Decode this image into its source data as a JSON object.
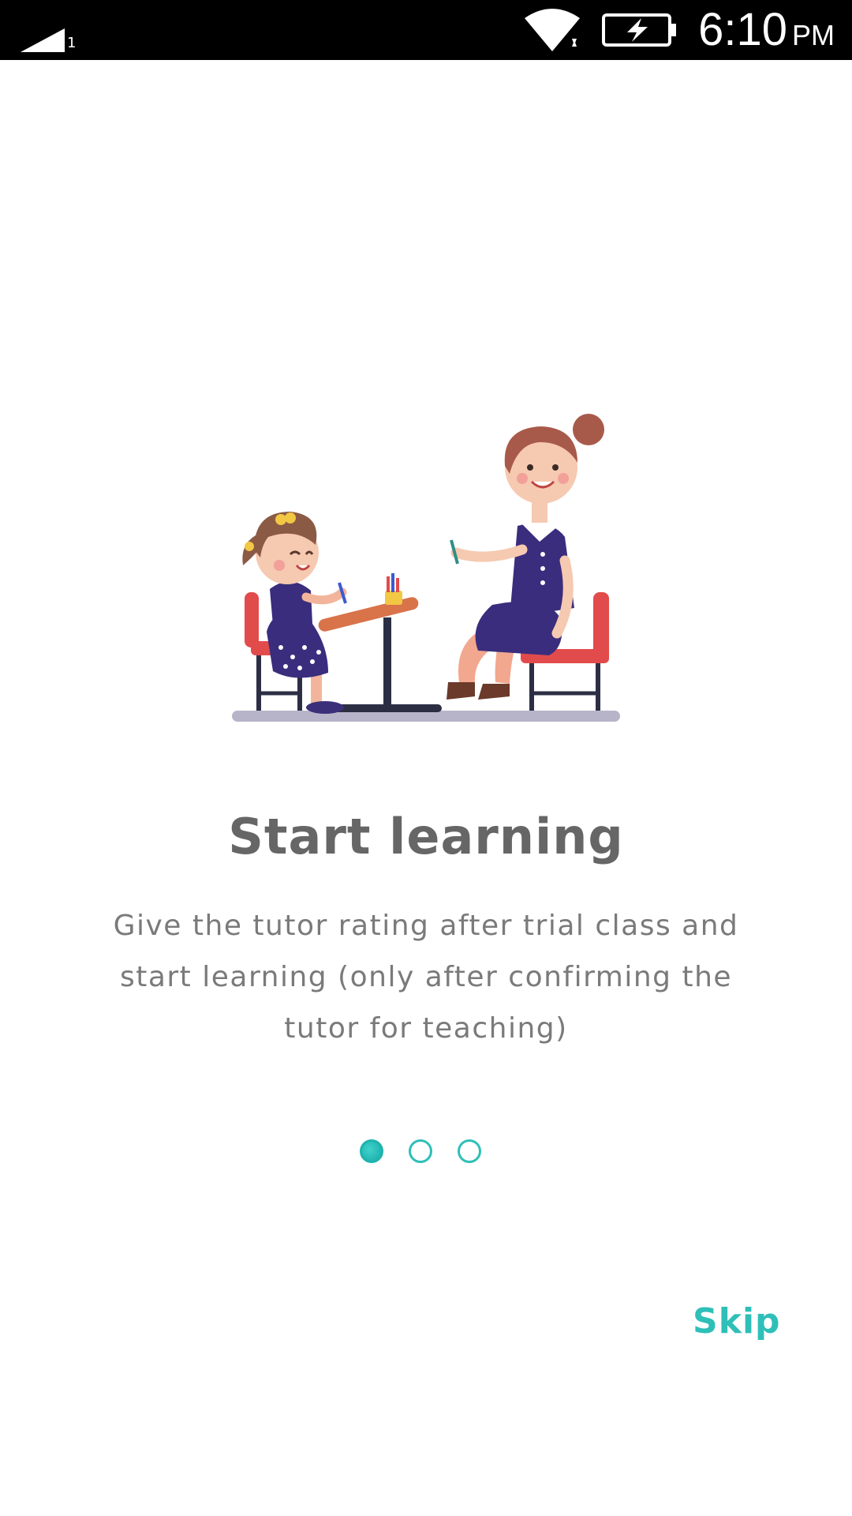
{
  "status_bar": {
    "signal_label": "1",
    "time": "6:10",
    "ampm": "PM",
    "icons": [
      "signal-icon",
      "wifi-icon",
      "battery-charging-icon"
    ]
  },
  "illustration": {
    "icon": "teacher-and-child-illustration"
  },
  "onboarding": {
    "title": "Start learning",
    "description": "Give the tutor rating after trial class and start learning (only after confirming the tutor for teaching)",
    "page_indicator": {
      "total_pages": 3,
      "current_page": 1
    },
    "skip_label": "Skip"
  },
  "colors": {
    "accent": "#2EBFB8",
    "title_text": "#666666",
    "body_text": "#7A7A7A",
    "status_bar_bg": "#000000",
    "background": "#FFFFFF"
  }
}
